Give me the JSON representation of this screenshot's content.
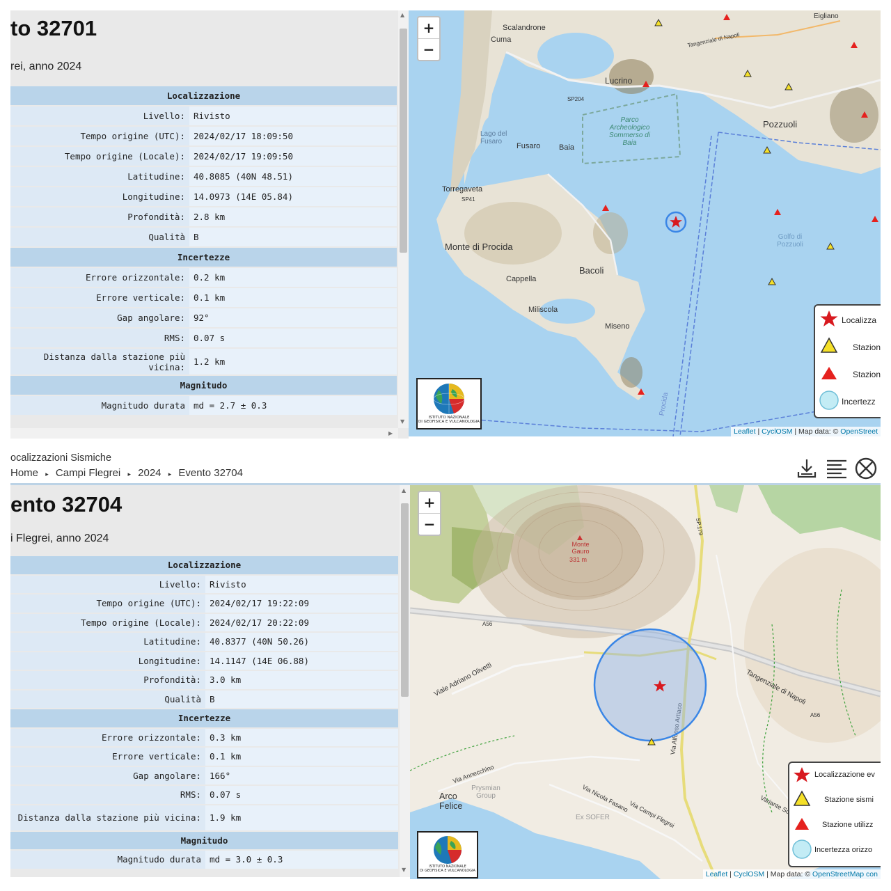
{
  "event1": {
    "title": "to 32701",
    "subtitle": "rei, anno 2024",
    "sections": {
      "loc": "Localizzazione",
      "unc": "Incertezze",
      "mag": "Magnitudo"
    },
    "rows": [
      {
        "label": "Livello:",
        "value": "Rivisto"
      },
      {
        "label": "Tempo origine (UTC):",
        "value": "2024/02/17 18:09:50"
      },
      {
        "label": "Tempo origine (Locale):",
        "value": "2024/02/17 19:09:50"
      },
      {
        "label": "Latitudine:",
        "value": "40.8085 (40N 48.51)"
      },
      {
        "label": "Longitudine:",
        "value": "14.0973 (14E 05.84)"
      },
      {
        "label": "Profondità:",
        "value": "2.8 km"
      },
      {
        "label": "Qualità",
        "value": "B"
      },
      {
        "label": "Errore orizzontale:",
        "value": "0.2 km"
      },
      {
        "label": "Errore verticale:",
        "value": "0.1 km"
      },
      {
        "label": "Gap angolare:",
        "value": "92°"
      },
      {
        "label": "RMS:",
        "value": "0.07 s"
      },
      {
        "label": "Distanza dalla stazione più vicina:",
        "value": "1.2 km"
      },
      {
        "label": "Magnitudo durata",
        "value": "md = 2.7 ± 0.3"
      }
    ],
    "map": {
      "zoom_in": "+",
      "zoom_out": "−",
      "places": [
        "Scalandrone",
        "Cuma",
        "Lucrino",
        "Pozzuoli",
        "Parco Archeologico Sommerso di Baia",
        "Lago del Fusaro",
        "Fusaro",
        "Baia",
        "Torregaveta",
        "Monte di Procida",
        "Bacoli",
        "Cappella",
        "Miliscola",
        "Miseno",
        "Golfo di Pozzuoli",
        "Eigliano",
        "Tangenziale di Napoli",
        "SP204",
        "SP41",
        "Procida"
      ],
      "legend": [
        "Localizza",
        "Stazion",
        "Stazion",
        "Incertezz"
      ],
      "attribution": {
        "leaflet": "Leaflet",
        "sep1": " | ",
        "cyclosm": "CyclOSM",
        "data": " | Map data: © ",
        "osm": "OpenStreet"
      }
    }
  },
  "header": {
    "app_title": "ocalizzazioni Sismiche",
    "breadcrumb": [
      "Home",
      "Campi Flegrei",
      "2024",
      "Evento 32704"
    ],
    "sep": "▸"
  },
  "event2": {
    "title": "ento 32704",
    "subtitle": "i Flegrei, anno 2024",
    "sections": {
      "loc": "Localizzazione",
      "unc": "Incertezze",
      "mag": "Magnitudo"
    },
    "rows": [
      {
        "label": "Livello:",
        "value": "Rivisto"
      },
      {
        "label": "Tempo origine (UTC):",
        "value": "2024/02/17 19:22:09"
      },
      {
        "label": "Tempo origine (Locale):",
        "value": "2024/02/17 20:22:09"
      },
      {
        "label": "Latitudine:",
        "value": "40.8377 (40N 50.26)"
      },
      {
        "label": "Longitudine:",
        "value": "14.1147 (14E 06.88)"
      },
      {
        "label": "Profondità:",
        "value": "3.0 km"
      },
      {
        "label": "Qualità",
        "value": "B"
      },
      {
        "label": "Errore orizzontale:",
        "value": "0.3 km"
      },
      {
        "label": "Errore verticale:",
        "value": "0.1 km"
      },
      {
        "label": "Gap angolare:",
        "value": "166°"
      },
      {
        "label": "RMS:",
        "value": "0.07 s"
      },
      {
        "label": "Distanza dalla stazione più vicina:",
        "value": "1.9 km"
      },
      {
        "label": "Magnitudo durata",
        "value": "md = 3.0 ± 0.3"
      }
    ],
    "map": {
      "zoom_in": "+",
      "zoom_out": "−",
      "places": [
        "Monte Gauro",
        "331 m",
        "A56",
        "Viale Adriano Olivetti",
        "Tangenziale di Napoli",
        "A56",
        "Via Alfonso Artiaco",
        "Via Annecchino",
        "Prysmian Group",
        "Arco Felice",
        "Via Nicola Fasano",
        "Via Campi Flegrei",
        "Ex SOFER",
        "Variante Solfatara",
        "SP.179"
      ],
      "legend": [
        "Localizzazione ev",
        "Stazione sismi",
        "Stazione utilizz",
        "Incertezza orizzo"
      ],
      "attribution": {
        "leaflet": "Leaflet",
        "sep1": " | ",
        "cyclosm": "CyclOSM",
        "data": " | Map data: © ",
        "osm": "OpenStreetMap con"
      }
    }
  },
  "logo_text": [
    "ISTITUTO NAZIONALE",
    "DI GEOFISICA E VULCANOLOGIA"
  ],
  "colors": {
    "section_header": "#b9d4ea",
    "row_label_bg": "#dde9f5",
    "row_value_bg": "#e8f1fa",
    "event_star": "#d8191f",
    "station_yellow": "#f5e028",
    "station_red": "#e5211e",
    "uncertainty_blue": "#3a86e6",
    "sea": "#a9d3f0"
  },
  "icons": {
    "download": "download-icon",
    "details": "details-list-icon",
    "close": "close-circle-icon"
  }
}
